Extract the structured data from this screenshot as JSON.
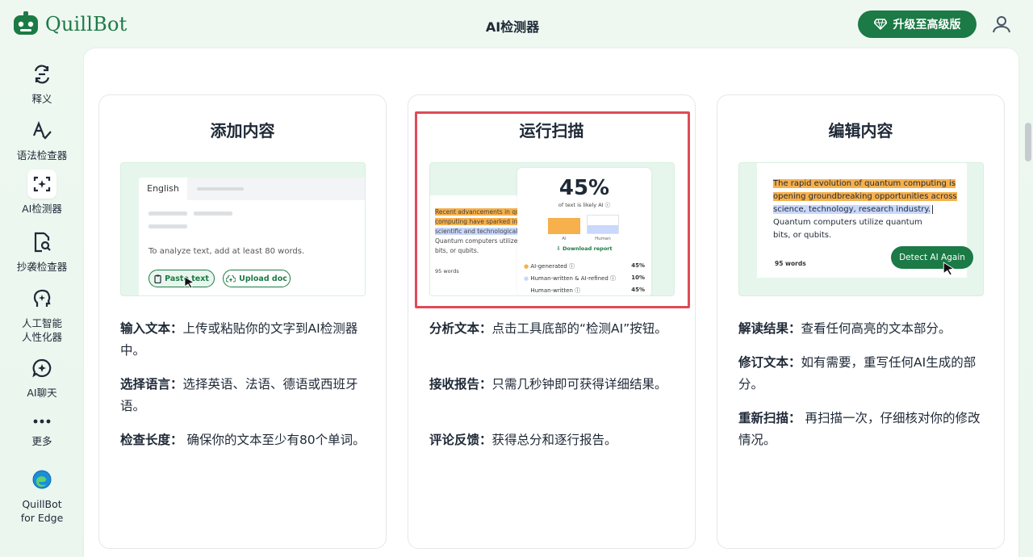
{
  "header": {
    "brand": "QuillBot",
    "title": "AI检测器",
    "upgrade_label": "升级至高级版"
  },
  "sidebar": {
    "items": [
      {
        "label": "释义",
        "icon": "paraphrase-icon"
      },
      {
        "label": "语法检查器",
        "icon": "grammar-icon"
      },
      {
        "label": "AI检测器",
        "icon": "ai-detector-icon"
      },
      {
        "label": "抄袭检查器",
        "icon": "plagiarism-icon"
      },
      {
        "label": "人工智能\n人性化器",
        "icon": "humanizer-icon"
      },
      {
        "label": "AI聊天",
        "icon": "ai-chat-icon"
      },
      {
        "label": "更多",
        "icon": "more-icon"
      },
      {
        "label": "QuillBot\nfor Edge",
        "icon": "edge-icon"
      }
    ]
  },
  "cards": [
    {
      "title": "添加内容",
      "illustration": {
        "tab_label": "English",
        "hint": "To analyze  text, add at least 80 words.",
        "paste_label": "Paste text",
        "upload_label": "Upload doc"
      },
      "desc": [
        {
          "term": "输入文本：",
          "text": "上传或粘贴你的文字到AI检测器中。"
        },
        {
          "term": "选择语言：",
          "text": "选择英语、法语、德语或西班牙语。"
        },
        {
          "term": "检查长度：",
          "text": " 确保你的文本至少有80个单词。"
        }
      ]
    },
    {
      "title": "运行扫描",
      "illustration": {
        "lines": [
          "Recent advancements in quan",
          "computing have sparked inter",
          "scientific and technological co",
          "Quantum computers utilize qu",
          "bits, or qubits."
        ],
        "word_count": "95 words",
        "percent": "45%",
        "percent_caption": "of text is likely AI ⓘ",
        "bar_ai_label": "AI",
        "bar_human_label": "Human",
        "download_label": "Download report",
        "rows": [
          {
            "label": "AI-generated ⓘ",
            "value": "45%"
          },
          {
            "label": "Human-written & AI-refined ⓘ",
            "value": "10%"
          },
          {
            "label": "Human-written ⓘ",
            "value": "45%"
          }
        ]
      },
      "desc": [
        {
          "term": "分析文本：",
          "text": "点击工具底部的“检测AI”按钮。"
        },
        {
          "term": "接收报告：",
          "text": "只需几秒钟即可获得详细结果。"
        },
        {
          "term": "评论反馈：",
          "text": "获得总分和逐行报告。"
        }
      ]
    },
    {
      "title": "编辑内容",
      "illustration": {
        "line1": "The rapid evolution of quantum computing is",
        "line2": "opening groundbreaking opportunities across",
        "line3": "science, technology, research industry.",
        "line4": "Quantum computers utilize quantum",
        "line5": "bits, or qubits.",
        "word_count": "95 words",
        "detect_label": "Detect AI Again"
      },
      "desc": [
        {
          "term": "解读结果：",
          "text": "查看任何高亮的文本部分。"
        },
        {
          "term": "修订文本：",
          "text": "如有需要，重写任何AI生成的部分。"
        },
        {
          "term": "重新扫描：",
          "text": " 再扫描一次，仔细核对你的修改情况。"
        }
      ]
    }
  ],
  "colors": {
    "brand_green": "#1b7a45",
    "highlight_orange": "#f6b04c",
    "highlight_blue": "#c9d8fb",
    "selection_red": "#e04a57"
  }
}
